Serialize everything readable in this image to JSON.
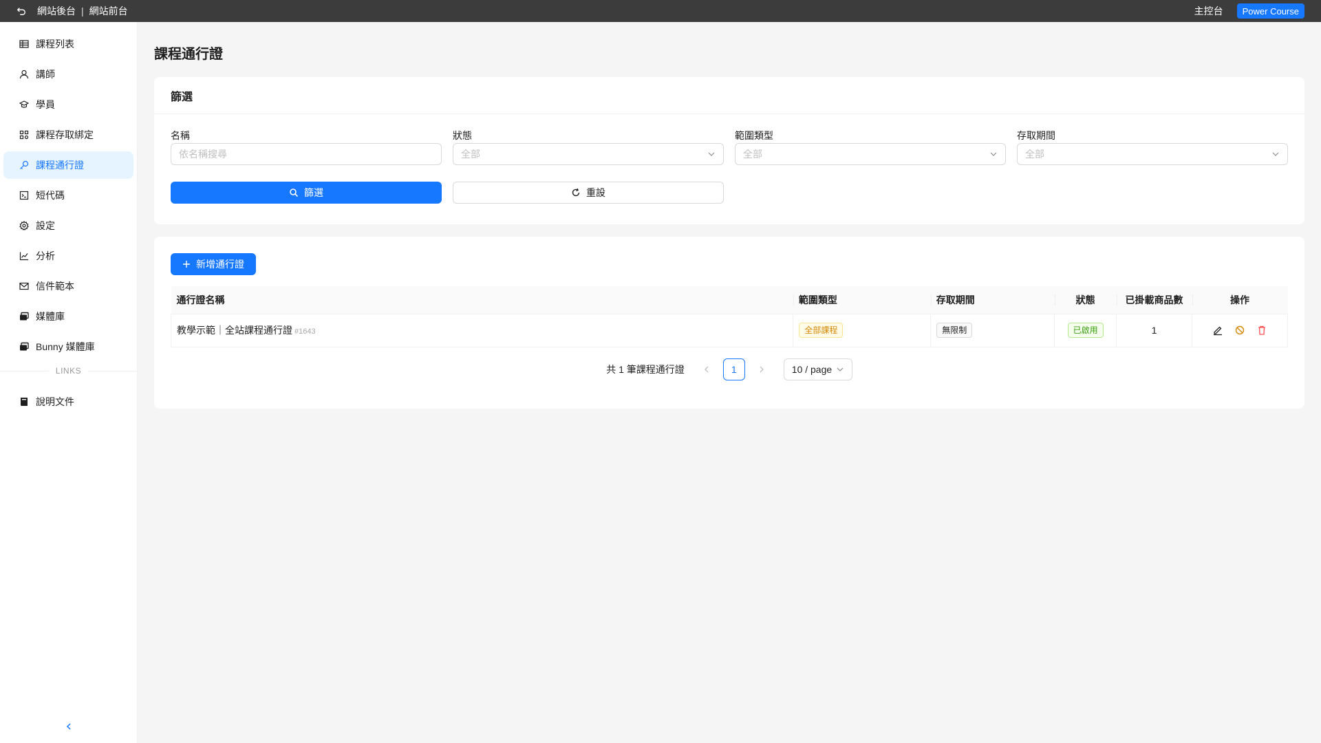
{
  "topbar": {
    "crumb_backend": "網站後台",
    "separator": "|",
    "crumb_frontend": "網站前台",
    "dashboard": "主控台",
    "brand": "Power Course"
  },
  "sidebar": {
    "items": [
      {
        "label": "課程列表",
        "icon": "table-icon"
      },
      {
        "label": "講師",
        "icon": "user-icon"
      },
      {
        "label": "學員",
        "icon": "graduation-cap-icon"
      },
      {
        "label": "課程存取綁定",
        "icon": "apps-icon"
      },
      {
        "label": "課程通行證",
        "icon": "key-icon"
      },
      {
        "label": "短代碼",
        "icon": "code-icon"
      },
      {
        "label": "設定",
        "icon": "gear-icon"
      },
      {
        "label": "分析",
        "icon": "line-chart-icon"
      },
      {
        "label": "信件範本",
        "icon": "mail-icon"
      },
      {
        "label": "媒體庫",
        "icon": "images-icon"
      },
      {
        "label": "Bunny 媒體庫",
        "icon": "images-icon"
      }
    ],
    "links_label": "LINKS",
    "link_items": [
      {
        "label": "說明文件",
        "icon": "book-icon"
      }
    ],
    "active_index": 4
  },
  "page": {
    "title": "課程通行證"
  },
  "filter": {
    "title": "篩選",
    "name_label": "名稱",
    "name_placeholder": "依名稱搜尋",
    "status_label": "狀態",
    "status_value": "全部",
    "scope_label": "範圍類型",
    "scope_value": "全部",
    "period_label": "存取期間",
    "period_value": "全部",
    "submit_label": "篩選",
    "reset_label": "重設"
  },
  "table": {
    "add_label": "新增通行證",
    "columns": [
      "通行證名稱",
      "範圍類型",
      "存取期間",
      "狀態",
      "已掛載商品數",
      "操作"
    ],
    "rows": [
      {
        "name": "教學示範｜全站課程通行證",
        "id": "#1643",
        "scope": "全部課程",
        "period": "無限制",
        "status": "已啟用",
        "count": "1"
      }
    ]
  },
  "pagination": {
    "total_text": "共 1 筆課程通行證",
    "current_page": "1",
    "page_size": "10 / page"
  },
  "colors": {
    "primary": "#1677ff",
    "topbar_bg": "#3c3c3c",
    "active_bg": "#e6f4ff"
  }
}
